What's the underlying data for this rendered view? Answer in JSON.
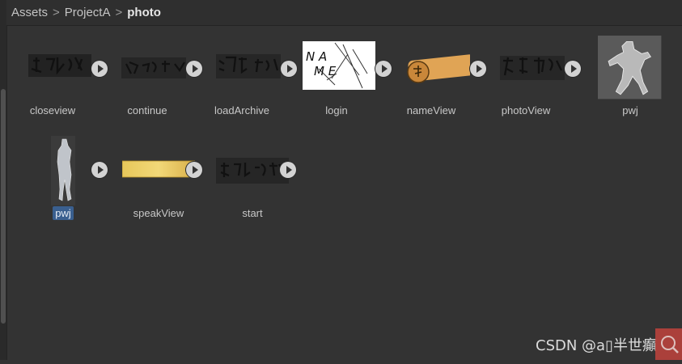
{
  "breadcrumb": {
    "items": [
      "Assets",
      "ProjectA",
      "photo"
    ],
    "separator": ">"
  },
  "assets": [
    {
      "name": "closeview",
      "type": "sprite-sheet",
      "selected": false,
      "has_play": true
    },
    {
      "name": "continue",
      "type": "sprite-sheet",
      "selected": false,
      "has_play": true
    },
    {
      "name": "loadArchive",
      "type": "sprite-sheet",
      "selected": false,
      "has_play": true
    },
    {
      "name": "login",
      "type": "sprite-sheet",
      "selected": false,
      "has_play": true
    },
    {
      "name": "nameView",
      "type": "sprite-sheet",
      "selected": false,
      "has_play": true
    },
    {
      "name": "photoView",
      "type": "sprite-sheet",
      "selected": false,
      "has_play": true
    },
    {
      "name": "pwj",
      "type": "texture",
      "selected": false,
      "has_play": false
    },
    {
      "name": "pwj",
      "type": "sprite-sheet",
      "selected": true,
      "has_play": true
    },
    {
      "name": "speakView",
      "type": "sprite-sheet",
      "selected": false,
      "has_play": true
    },
    {
      "name": "start",
      "type": "sprite-sheet",
      "selected": false,
      "has_play": true
    }
  ],
  "watermark": "CSDN @a▯半世癲",
  "colors": {
    "background": "#333333",
    "selection": "#3a5f8f",
    "play_button": "#d3d3d3",
    "name_plate": "#e0a455",
    "speak_gradient": "#e7c75a"
  }
}
